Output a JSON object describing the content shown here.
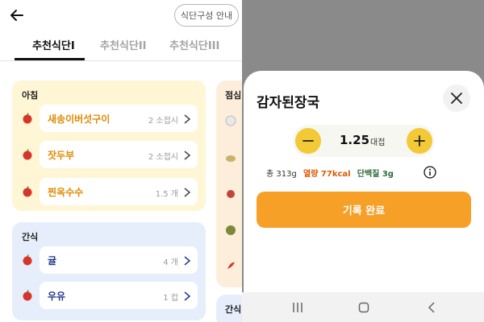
{
  "left": {
    "header": {
      "guide_label": "식단구성 안내"
    },
    "tabs": [
      {
        "label": "추천식단I",
        "active": true
      },
      {
        "label": "추천식단II",
        "active": false
      },
      {
        "label": "추천식단III",
        "active": false
      }
    ],
    "meals": {
      "morning": {
        "title": "아침",
        "items": [
          {
            "name": "새송이버섯구이",
            "amount": "2 소접시"
          },
          {
            "name": "잣두부",
            "amount": "2 소접시"
          },
          {
            "name": "찐옥수수",
            "amount": "1.5 개"
          }
        ]
      },
      "snack": {
        "title": "간식",
        "items": [
          {
            "name": "귤",
            "amount": "4 개"
          },
          {
            "name": "우유",
            "amount": "1 컵"
          }
        ]
      },
      "lunch": {
        "title": "점심"
      },
      "snack2": {
        "title": "간식"
      }
    }
  },
  "right": {
    "food": {
      "title": "감자된장국",
      "quantity": "1.25",
      "unit": "대접",
      "total": "총 313g",
      "calories": "열량 77kcal",
      "protein": "단백질 3g"
    },
    "done_label": "기록 완료"
  },
  "colors": {
    "accent_orange": "#f6a028",
    "stepper_yellow": "#f3c936",
    "morning_bg": "#fff6d6",
    "snack_bg": "#e6eefb"
  },
  "icons": [
    "back-arrow-icon",
    "apple-icon",
    "chevron-right-icon",
    "close-icon",
    "minus-icon",
    "plus-icon",
    "info-icon",
    "nav-recents-icon",
    "nav-home-icon",
    "nav-back-icon"
  ]
}
